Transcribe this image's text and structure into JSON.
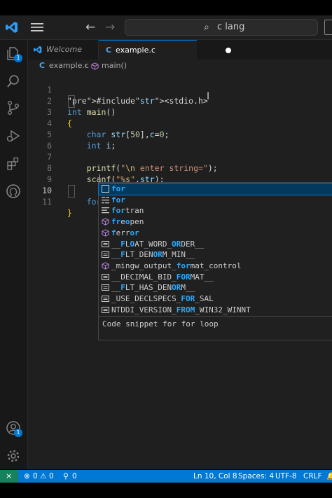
{
  "titlebar": {
    "search_text": "c lang"
  },
  "activity_badges": {
    "explorer": "1",
    "accounts": "1"
  },
  "tabs": [
    {
      "label": "Welcome",
      "icon": "vscode-logo-icon"
    },
    {
      "label": "example.c",
      "icon_letter": "C",
      "dirty": true
    }
  ],
  "breadcrumb": {
    "file_icon": "C",
    "file": "example.c",
    "symbol": "main()"
  },
  "editor": {
    "line_numbers": [
      "1",
      "2",
      "3",
      "4",
      "5",
      "6",
      "7",
      "8",
      "9",
      "10",
      "11"
    ],
    "lines": [
      "#include<stdio.h>",
      "int main()",
      "{",
      "    char str[50],c=0;",
      "    int i;",
      "",
      "    printf(\"\\n enter string=\");",
      "    scanf(\"%s\",str);",
      "",
      "    for",
      "}"
    ]
  },
  "suggestions": {
    "items": [
      {
        "kind": "snippet",
        "pre": "",
        "hl": "for",
        "post": "",
        "selected": true
      },
      {
        "kind": "keyword",
        "pre": "",
        "hl": "for",
        "post": ""
      },
      {
        "kind": "text",
        "pre": "",
        "hl": "for",
        "post": "tran"
      },
      {
        "kind": "function",
        "pre": "",
        "hl": "fr",
        "post": "e",
        "hl2": "o",
        "post2": "pen"
      },
      {
        "kind": "function",
        "pre": "",
        "hl": "f",
        "post": "err",
        "hl2": "or",
        "post2": ""
      },
      {
        "kind": "constant",
        "pre": "__",
        "hl": "F",
        "post": "L",
        "hl2": "O",
        "post2": "AT_WORD_",
        "hl3": "OR",
        "post3": "DER__"
      },
      {
        "kind": "constant",
        "pre": "__",
        "hl": "F",
        "post": "LT_DEN",
        "hl2": "OR",
        "post2": "M_MIN__"
      },
      {
        "kind": "function",
        "pre": "_mingw_output_",
        "hl": "for",
        "post": "mat_control"
      },
      {
        "kind": "constant",
        "pre": "__DECIMAL_BID_",
        "hl": "FOR",
        "post": "MAT__"
      },
      {
        "kind": "constant",
        "pre": "__",
        "hl": "F",
        "post": "LT_HAS_DEN",
        "hl2": "OR",
        "post2": "M__"
      },
      {
        "kind": "constant",
        "pre": "_USE_DECLSPECS_",
        "hl": "FOR",
        "post": "_SAL"
      },
      {
        "kind": "constant",
        "pre": "NTDDI_VERSION_",
        "hl": "FROM",
        "post": "_WIN32_WINNT"
      }
    ],
    "doc": "Code snippet for for loop"
  },
  "statusbar": {
    "errors": "0",
    "warnings": "0",
    "ports": "0",
    "position": "Ln 10, Col 8",
    "spaces": "Spaces: 4",
    "encoding": "UTF-8",
    "eol": "CRLF"
  },
  "colors": {
    "accent": "#0078d4",
    "remote": "#16825d",
    "match": "#2aaaff"
  }
}
